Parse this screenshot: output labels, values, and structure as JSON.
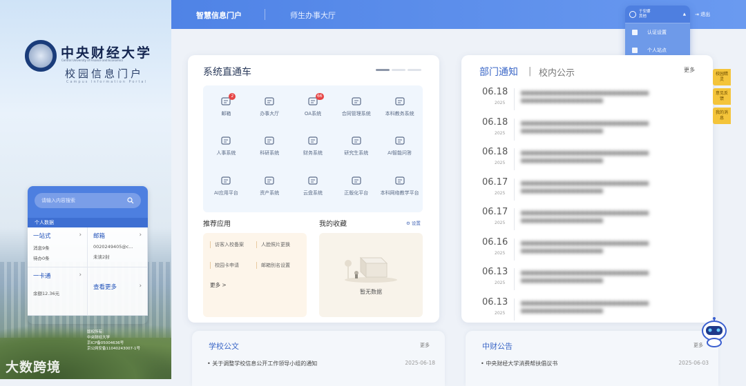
{
  "brand": {
    "cn_name": "中央财经大学",
    "en_name": "Central University of Finance and Economics",
    "portal_title": "校园信息门户",
    "portal_en": "Campus Information Portal"
  },
  "topnav": {
    "tab_active": "智慧信息门户",
    "tab_other": "师生办事大厅",
    "logout": "退出"
  },
  "user_menu": {
    "name": "于安娜",
    "role": "其他",
    "items": [
      "认证设置",
      "个人站点"
    ]
  },
  "quick": {
    "search_placeholder": "请输入内容搜索",
    "section_title": "个人数据",
    "onestop": {
      "title": "一站式",
      "line1": "消息9条",
      "line2": "待办0条"
    },
    "mail": {
      "title": "邮箱",
      "line1": "0020249405@c...",
      "line2": "未读2封"
    },
    "card": {
      "title": "一卡通",
      "line1": "余额12.36元"
    },
    "more": "查看更多"
  },
  "footer_info": {
    "line1": "版权所有:",
    "line2": "中央财经大学",
    "line3": "京ICP备05004636号",
    "line4": "京公网安备11040243007-1号"
  },
  "watermark": "大数跨境",
  "systems": {
    "title": "系统直通车",
    "items": [
      {
        "label": "邮箱",
        "badge": "2"
      },
      {
        "label": "办事大厅",
        "badge": ""
      },
      {
        "label": "OA系统",
        "badge": "66"
      },
      {
        "label": "合同管理系统",
        "badge": ""
      },
      {
        "label": "本科教务系统",
        "badge": ""
      },
      {
        "label": "人事系统",
        "badge": ""
      },
      {
        "label": "科研系统",
        "badge": ""
      },
      {
        "label": "财务系统",
        "badge": ""
      },
      {
        "label": "研究生系统",
        "badge": ""
      },
      {
        "label": "AI智能问答",
        "badge": ""
      },
      {
        "label": "AI应用平台",
        "badge": ""
      },
      {
        "label": "资产系统",
        "badge": ""
      },
      {
        "label": "云盘系统",
        "badge": ""
      },
      {
        "label": "正版化平台",
        "badge": ""
      },
      {
        "label": "本科网络教学平台",
        "badge": ""
      }
    ]
  },
  "recommended": {
    "title": "推荐应用",
    "items": [
      "访客入校备案",
      "人脸照片更换",
      "校园卡申请",
      "邮箱别名设置"
    ],
    "more": "更多 >"
  },
  "favorites": {
    "title": "我的收藏",
    "settings": "设置",
    "empty": "暂无数据"
  },
  "notices": {
    "tab_active": "部门通知",
    "tab_other": "校内公示",
    "more": "更多",
    "items": [
      {
        "date": "06.18",
        "year": "2025"
      },
      {
        "date": "06.18",
        "year": "2025"
      },
      {
        "date": "06.18",
        "year": "2025"
      },
      {
        "date": "06.17",
        "year": "2025"
      },
      {
        "date": "06.17",
        "year": "2025"
      },
      {
        "date": "06.16",
        "year": "2025"
      },
      {
        "date": "06.13",
        "year": "2025"
      },
      {
        "date": "06.13",
        "year": "2025"
      }
    ]
  },
  "side_tabs": [
    "校园精灵",
    "意见反馈",
    "我的消息"
  ],
  "school_docs": {
    "title": "学校公文",
    "more": "更多",
    "row1": "关于调整学校信息公开工作领导小组的通知",
    "row1_date": "2025-06-18"
  },
  "cufe_notice": {
    "title": "中财公告",
    "more": "更多",
    "row1": "中央财经大学消费帮扶倡议书",
    "row1_date": "2025-06-03"
  }
}
